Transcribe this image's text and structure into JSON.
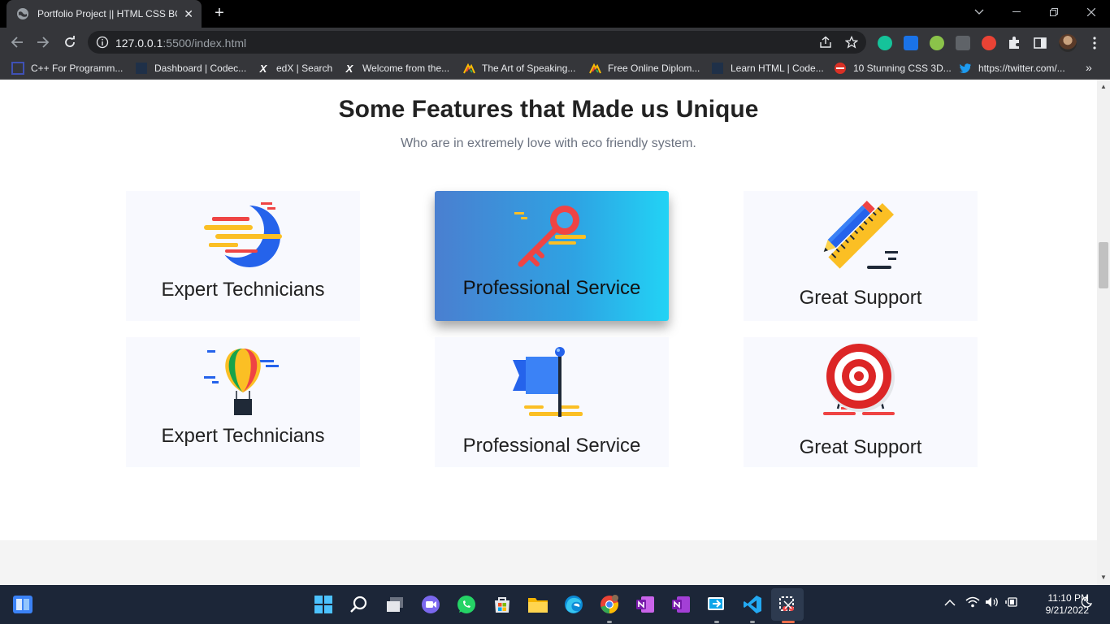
{
  "browser": {
    "tab_title": "Portfolio Project || HTML CSS BOOTSTRAP",
    "url_host": "127.0.0.1",
    "url_path": ":5500/index.html"
  },
  "bookmarks": [
    {
      "label": "C++ For Programm...",
      "icon": "cpp-icon"
    },
    {
      "label": "Dashboard | Codec...",
      "icon": "codecademy-icon"
    },
    {
      "label": "edX | Search",
      "icon": "edx-icon"
    },
    {
      "label": "Welcome from the...",
      "icon": "edx-icon"
    },
    {
      "label": "The Art of Speaking...",
      "icon": "alison-icon"
    },
    {
      "label": "Free Online Diplom...",
      "icon": "alison-icon"
    },
    {
      "label": "Learn HTML | Code...",
      "icon": "codecademy-icon"
    },
    {
      "label": "10 Stunning CSS 3D...",
      "icon": "red-circle-icon"
    },
    {
      "label": "https://twitter.com/...",
      "icon": "twitter-icon"
    }
  ],
  "page": {
    "title": "Some Features that Made us Unique",
    "subtitle": "Who are in extremely love with eco friendly system.",
    "features": [
      {
        "label": "Expert Technicians",
        "icon": "moon-icon"
      },
      {
        "label": "Professional Service",
        "icon": "key-icon"
      },
      {
        "label": "Great Support",
        "icon": "pencil-ruler-icon"
      },
      {
        "label": "Expert Technicians",
        "icon": "balloon-icon"
      },
      {
        "label": "Professional Service",
        "icon": "flag-icon"
      },
      {
        "label": "Great Support",
        "icon": "target-icon"
      }
    ]
  },
  "taskbar": {
    "time": "11:10 PM",
    "date": "9/21/2022"
  },
  "colors": {
    "accent_gradient_start": "#4a7fd0",
    "accent_gradient_end": "#22d3f5",
    "card_bg": "#f8f9fe",
    "taskbar_bg": "#1c2638"
  }
}
